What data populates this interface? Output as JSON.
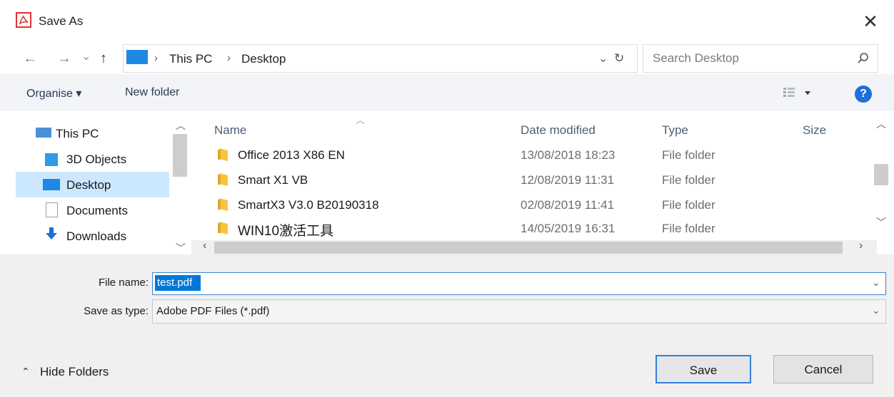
{
  "window": {
    "title": "Save As",
    "close_glyph": "✕"
  },
  "nav": {
    "back_glyph": "←",
    "forward_glyph": "→",
    "recent_glyph": "⌄",
    "up_glyph": "↑",
    "breadcrumb": [
      "This PC",
      "Desktop"
    ],
    "crumb_sep": "›",
    "search_placeholder": "Search Desktop"
  },
  "toolbar": {
    "organise_label": "Organise ▾",
    "new_folder_label": "New folder",
    "help_glyph": "?"
  },
  "sidebar": {
    "items": [
      {
        "label": "This PC",
        "icon": "pc-icon"
      },
      {
        "label": "3D Objects",
        "icon": "cube-icon"
      },
      {
        "label": "Desktop",
        "icon": "desktop-icon",
        "selected": true
      },
      {
        "label": "Documents",
        "icon": "document-icon"
      },
      {
        "label": "Downloads",
        "icon": "download-icon"
      }
    ]
  },
  "file_list": {
    "columns": {
      "name": "Name",
      "date": "Date modified",
      "type": "Type",
      "size": "Size"
    },
    "rows": [
      {
        "name": "Office 2013 X86 EN",
        "date": "13/08/2018 18:23",
        "type": "File folder"
      },
      {
        "name": "Smart X1 VB",
        "date": "12/08/2019 11:31",
        "type": "File folder"
      },
      {
        "name": "SmartX3 V3.0 B20190318",
        "date": "02/08/2019 11:41",
        "type": "File folder"
      },
      {
        "name": "WIN10激活工具",
        "date": "14/05/2019 16:31",
        "type": "File folder"
      }
    ]
  },
  "form": {
    "file_name_label": "File name:",
    "file_name_value": "test.pdf",
    "save_type_label": "Save as type:",
    "save_type_value": "Adobe PDF Files (*.pdf)"
  },
  "footer": {
    "hide_folders_label": "Hide Folders",
    "save_label": "Save",
    "cancel_label": "Cancel"
  },
  "colors": {
    "accent": "#0078d7",
    "selection": "#cce8ff",
    "folder": "#f5c542"
  }
}
